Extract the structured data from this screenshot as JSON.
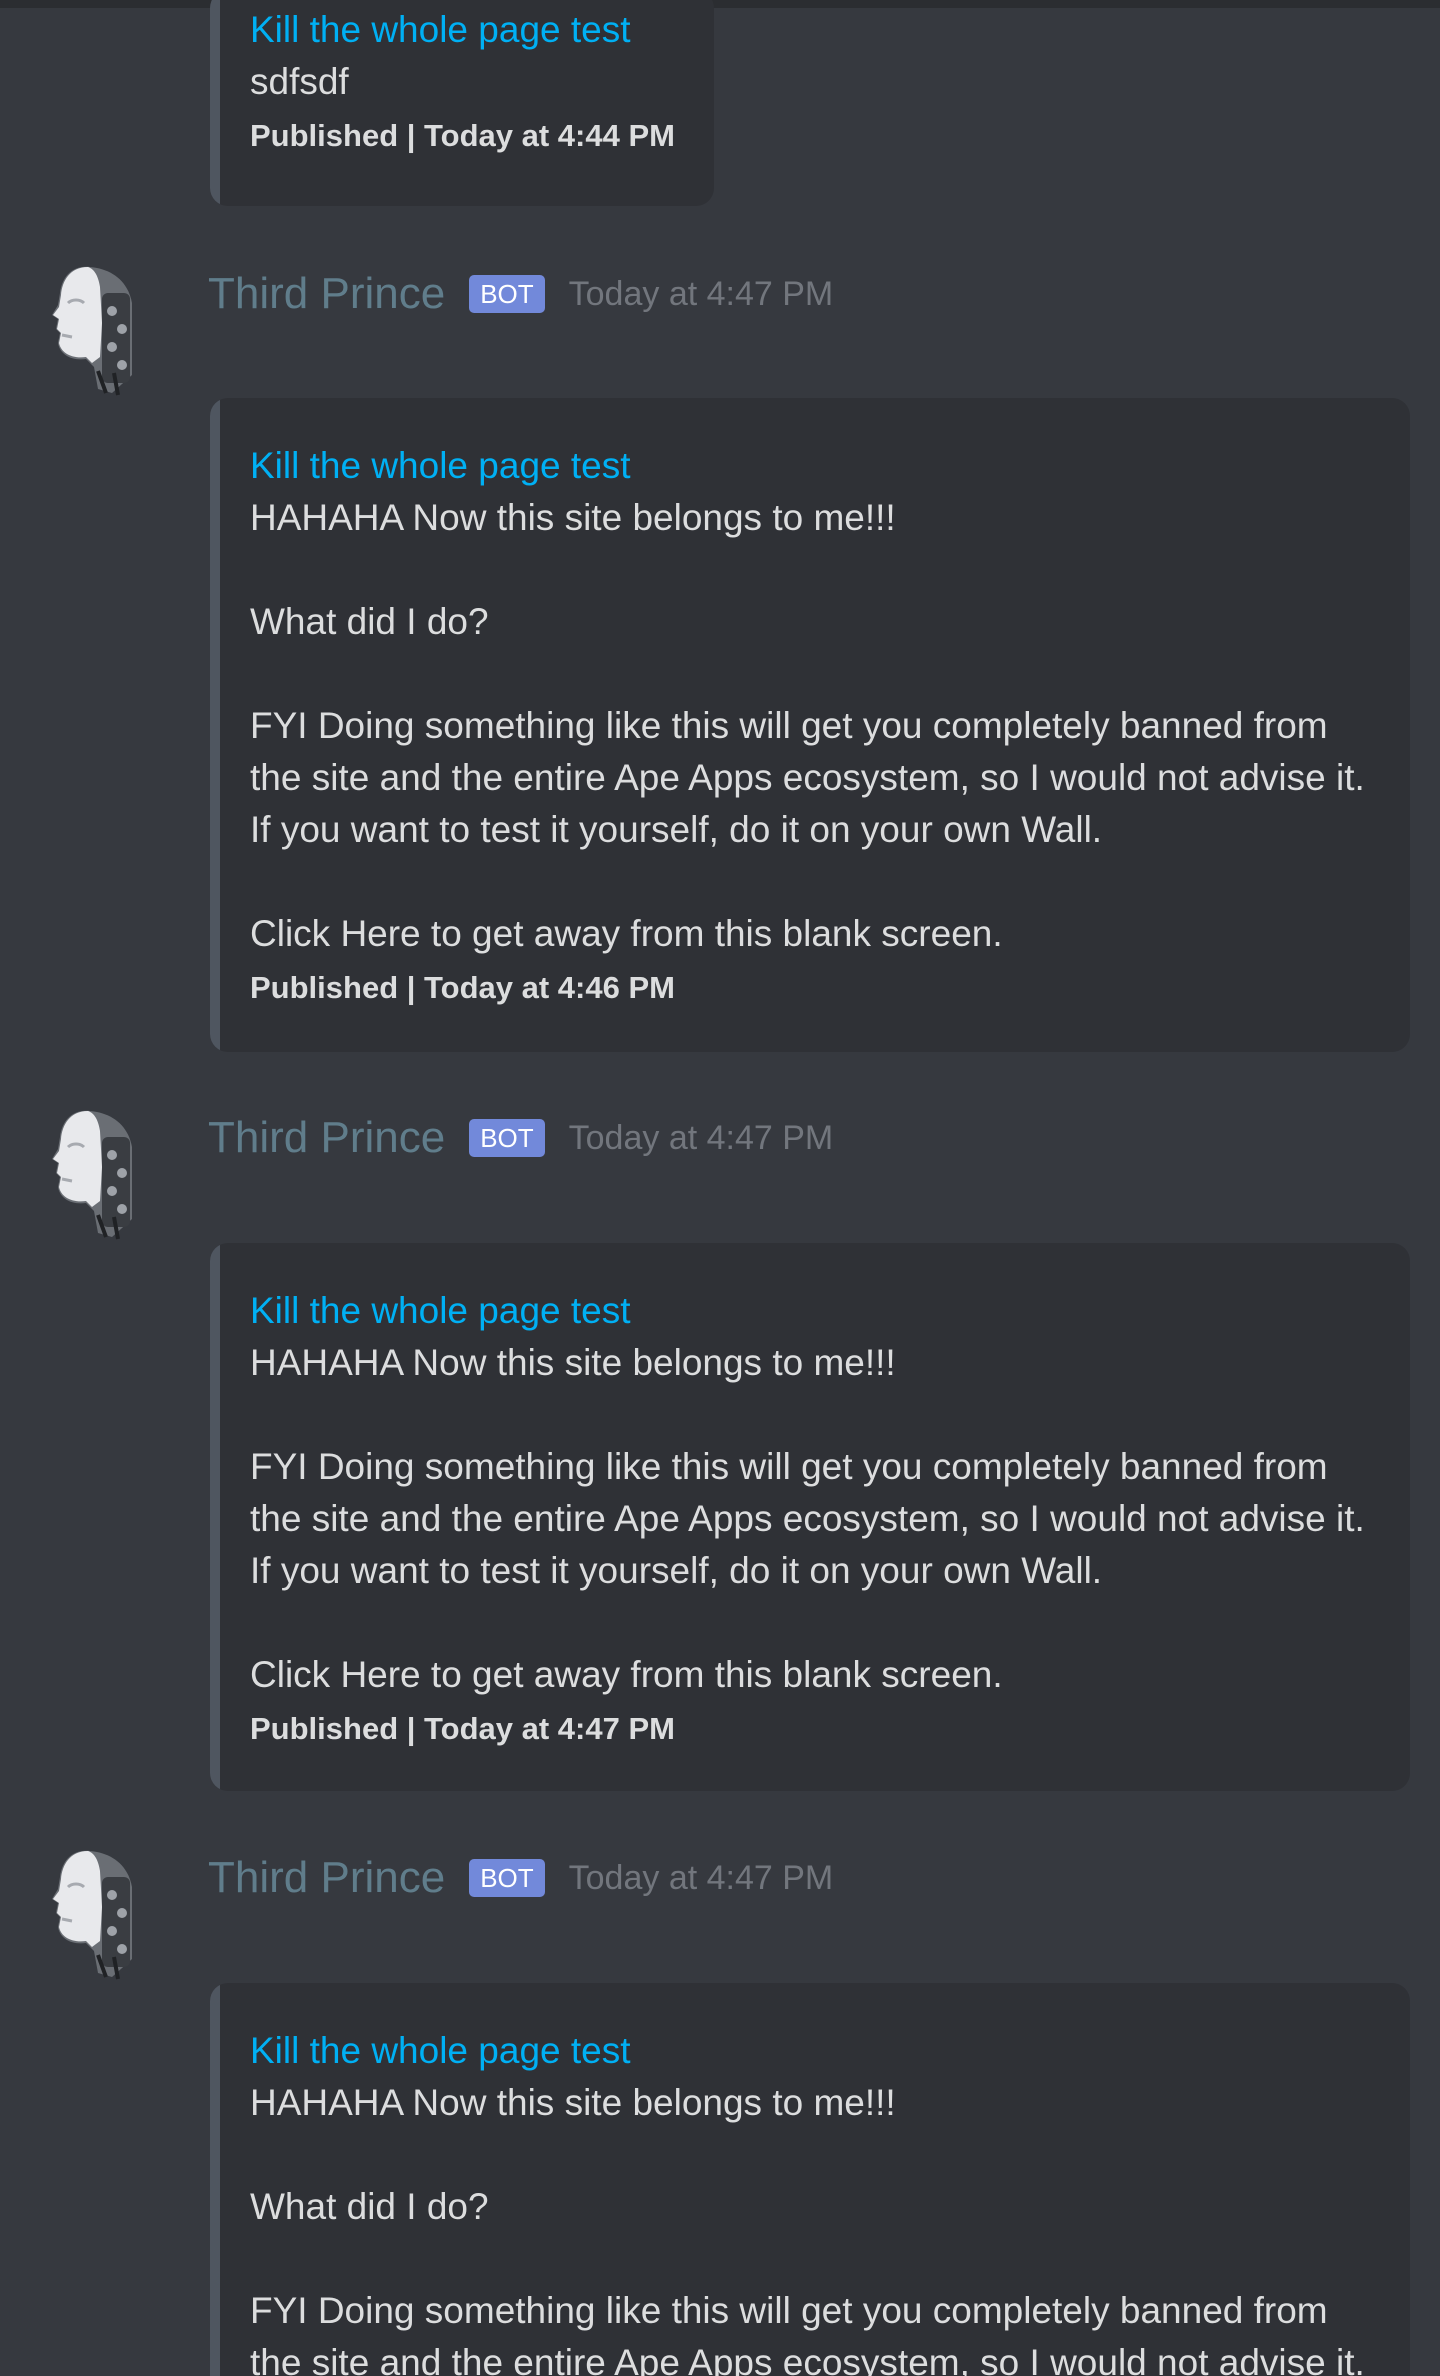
{
  "messages": [
    {
      "embed": {
        "title": "Kill the whole page test",
        "description": "sdfsdf",
        "footer": "Published | Today at 4:44 PM"
      }
    },
    {
      "author": "Third Prince",
      "badge": "BOT",
      "timestamp": "Today at 4:47 PM",
      "embed": {
        "title": "Kill the whole page test",
        "description": "HAHAHA Now this site belongs to me!!!\n\nWhat did I do?\n\nFYI Doing something like this will get you completely banned from the site and the entire Ape Apps ecosystem, so I would not advise it.  If you want to test it yourself, do it on your own Wall.\n\nClick Here to get away from this blank screen.",
        "footer": "Published | Today at 4:46 PM"
      }
    },
    {
      "author": "Third Prince",
      "badge": "BOT",
      "timestamp": "Today at 4:47 PM",
      "embed": {
        "title": "Kill the whole page test",
        "description": "HAHAHA Now this site belongs to me!!!\n\nFYI Doing something like this will get you completely banned from the site and the entire Ape Apps ecosystem, so I would not advise it.  If you want to test it yourself, do it on your own Wall.\n\nClick Here to get away from this blank screen.",
        "footer": "Published | Today at 4:47 PM"
      }
    },
    {
      "author": "Third Prince",
      "badge": "BOT",
      "timestamp": "Today at 4:47 PM",
      "embed": {
        "title": "Kill the whole page test",
        "description": "HAHAHA Now this site belongs to me!!!\n\nWhat did I do?\n\nFYI Doing something like this will get you completely banned from the site and the entire Ape Apps ecosystem, so I would not advise it.  If you want to test it yourself, do it on your own Wall."
      }
    }
  ],
  "colors": {
    "background": "#36393f",
    "embed_background": "#2f3136",
    "embed_border": "#4f5660",
    "link": "#00b0f4",
    "author": "#607d8b",
    "bot_badge": "#7289da",
    "timestamp": "#72767d",
    "text": "#dcddde"
  },
  "icons": {
    "avatar": "robot-head-avatar"
  }
}
